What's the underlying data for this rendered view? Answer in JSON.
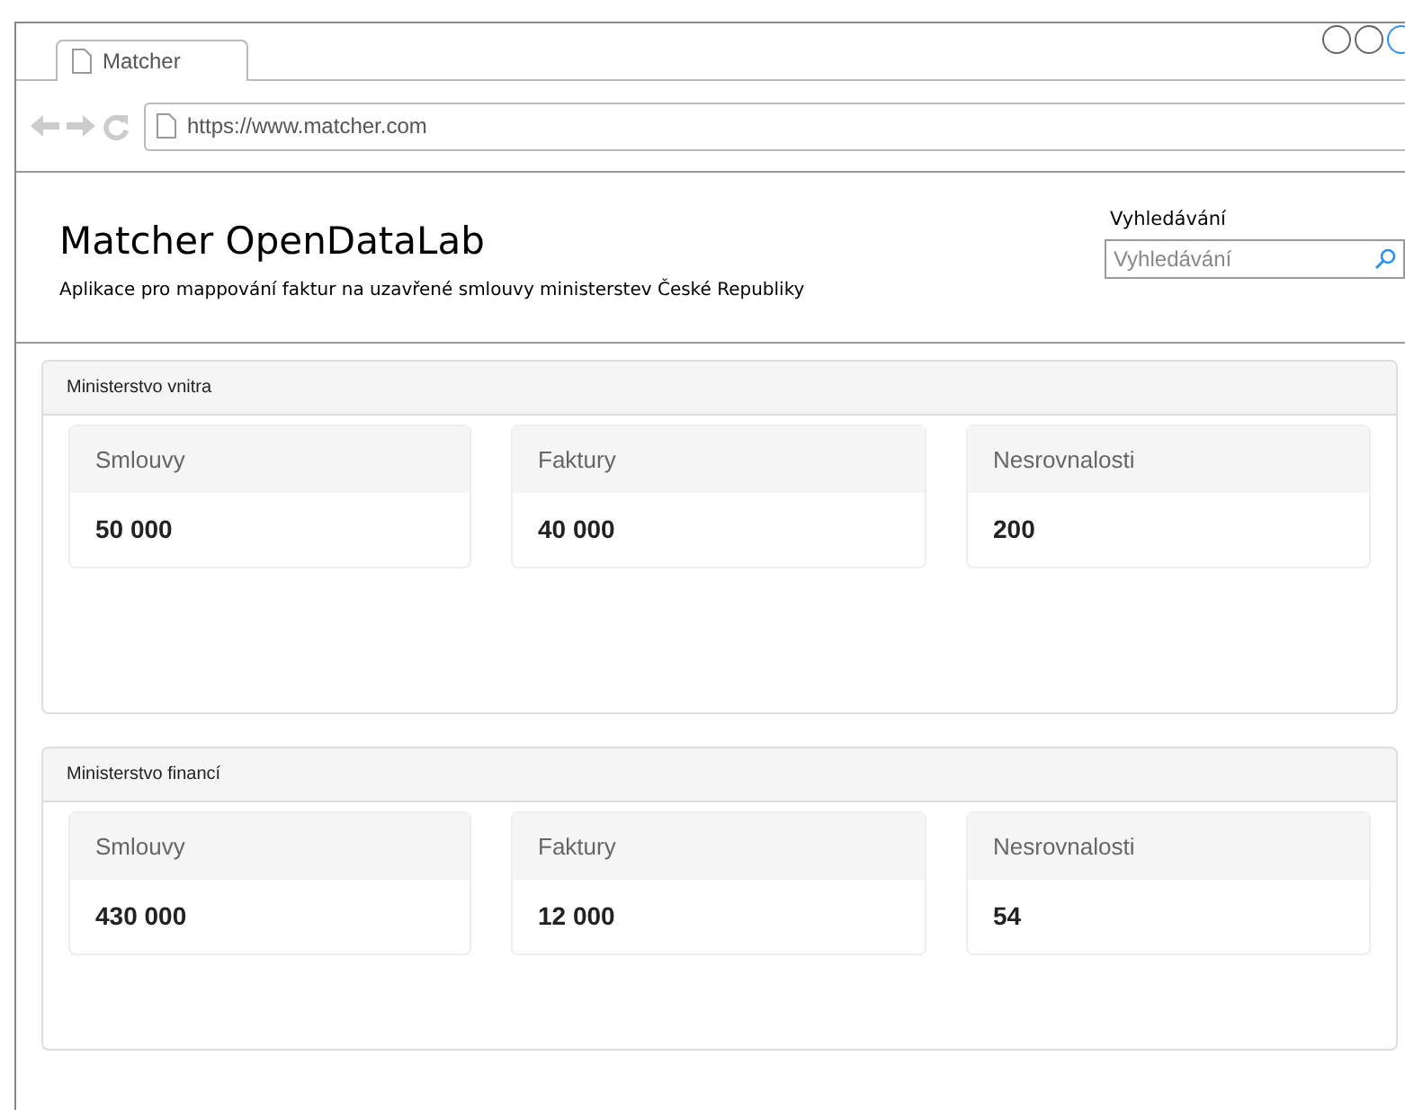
{
  "browser": {
    "tab_title": "Matcher",
    "url": "https://www.matcher.com"
  },
  "header": {
    "title": "Matcher OpenDataLab",
    "subtitle": "Aplikace pro mappování faktur na uzavřené smlouvy ministerstev České Republiky",
    "search_label": "Vyhledávání",
    "search_placeholder": "Vyhledávání"
  },
  "panels": [
    {
      "title": "Ministerstvo vnitra",
      "cards": [
        {
          "label": "Smlouvy",
          "value": "50 000"
        },
        {
          "label": "Faktury",
          "value": "40 000"
        },
        {
          "label": "Nesrovnalosti",
          "value": "200"
        }
      ]
    },
    {
      "title": "Ministerstvo financí",
      "cards": [
        {
          "label": "Smlouvy",
          "value": "430 000"
        },
        {
          "label": "Faktury",
          "value": "12 000"
        },
        {
          "label": "Nesrovnalosti",
          "value": "54"
        }
      ]
    }
  ]
}
